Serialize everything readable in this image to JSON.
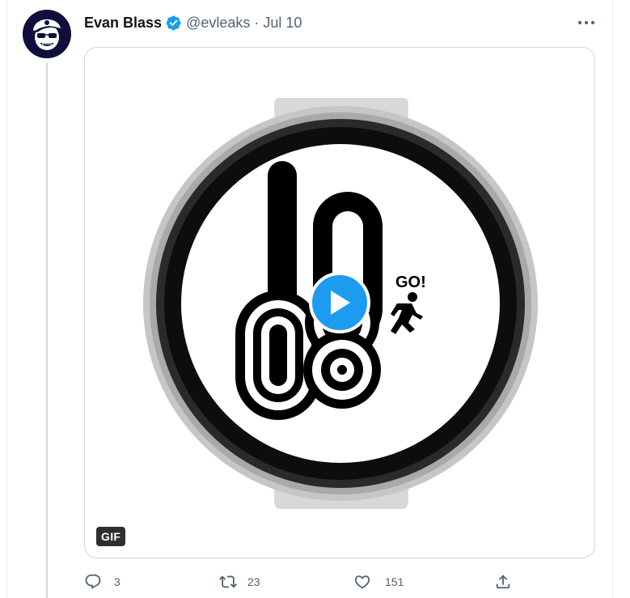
{
  "tweet": {
    "author_name": "Evan Blass",
    "handle": "@evleaks",
    "separator": "·",
    "date": "Jul 10",
    "verified": true
  },
  "media": {
    "type": "gif",
    "badge": "GIF",
    "watch_face": {
      "hour_digits": "10",
      "minute_digits": "08",
      "caption": "GO!"
    }
  },
  "actions": {
    "reply_count": "3",
    "retweet_count": "23",
    "like_count": "151"
  },
  "icons": {
    "verified": "verified-badge-icon",
    "more": "more-options-icon",
    "play": "play-icon",
    "reply": "reply-icon",
    "retweet": "retweet-icon",
    "like": "heart-icon",
    "share": "share-icon"
  },
  "colors": {
    "accent": "#1d9bf0",
    "text_primary": "#0f1419",
    "text_secondary": "#536471",
    "border": "#cfd9de",
    "avatar_bg": "#0f0e3c"
  }
}
